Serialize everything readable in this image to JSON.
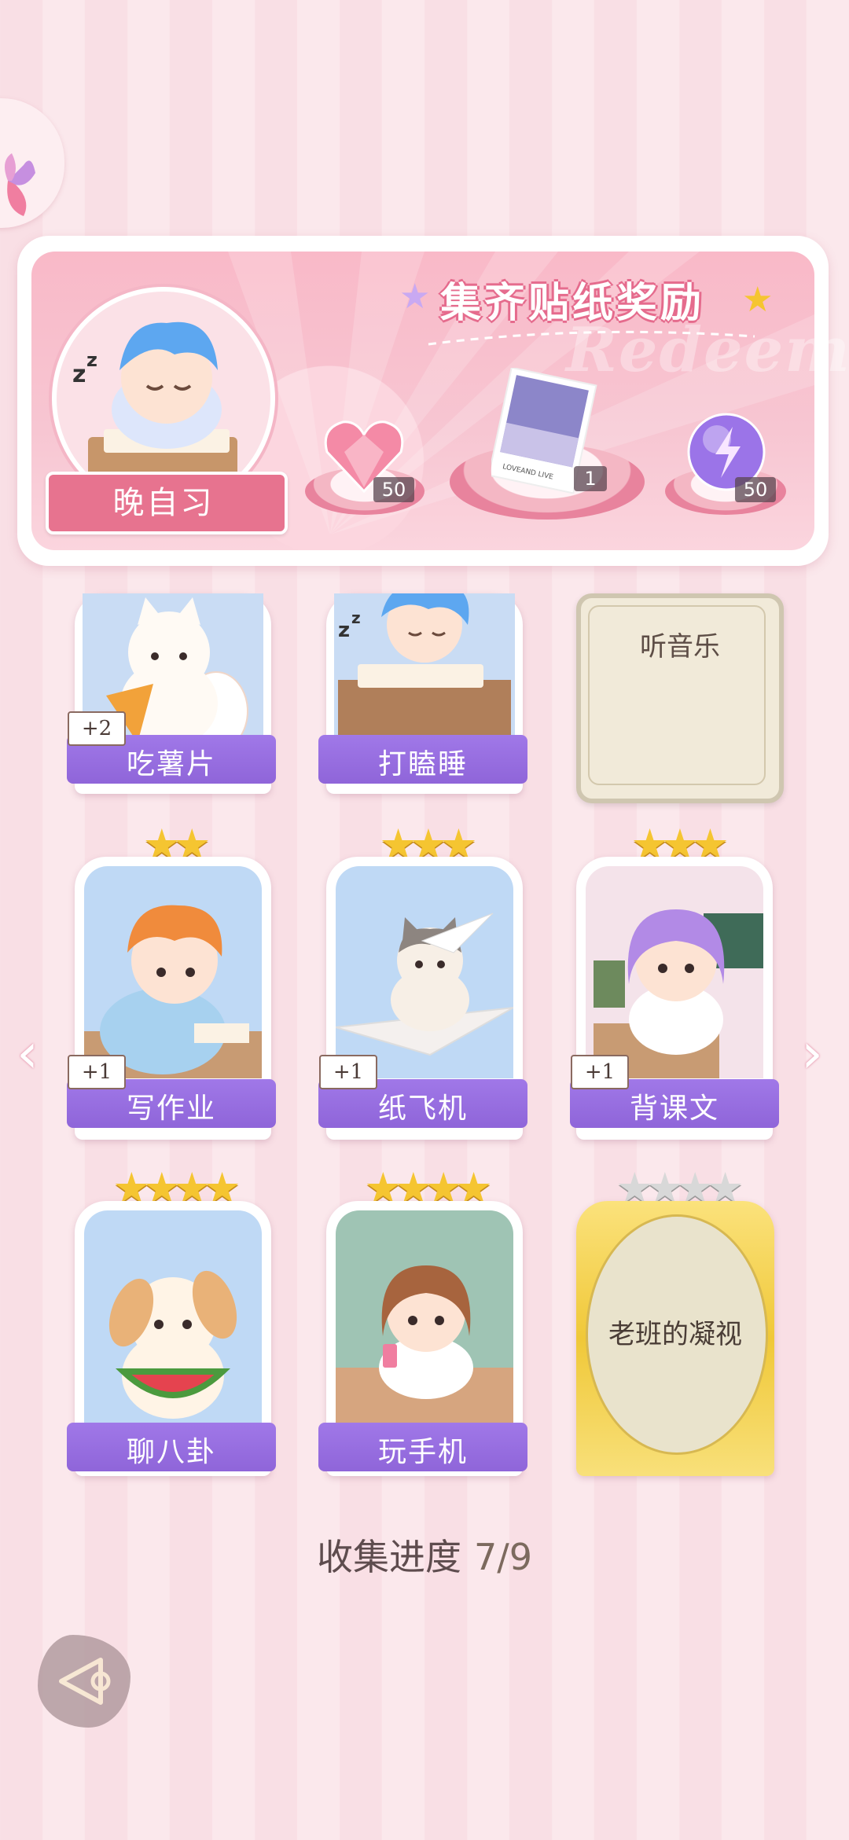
{
  "banner": {
    "title": "集齐贴纸奖励",
    "watermark": "Redeem",
    "sticker_name": "晚自习",
    "rewards": [
      {
        "icon": "pink-heart-gem-icon",
        "count": "50"
      },
      {
        "icon": "photo-card-icon",
        "count": "1",
        "photo_caption": "LOVEAND LIVE"
      },
      {
        "icon": "purple-energy-orb-icon",
        "count": "50"
      }
    ]
  },
  "cards": {
    "row1": [
      {
        "label": "吃薯片",
        "plus": "+2",
        "stars": 0,
        "art": "cat-eating-chips"
      },
      {
        "label": "打瞌睡",
        "plus": "",
        "stars": 0,
        "art": "boy-sleeping-desk"
      },
      {
        "label": "听音乐",
        "locked": true
      }
    ],
    "row2": [
      {
        "label": "写作业",
        "plus": "+1",
        "stars": 2,
        "art": "boy-writing"
      },
      {
        "label": "纸飞机",
        "plus": "+1",
        "stars": 3,
        "art": "cat-paper-plane"
      },
      {
        "label": "背课文",
        "plus": "+1",
        "stars": 3,
        "art": "girl-reciting"
      }
    ],
    "row3": [
      {
        "label": "聊八卦",
        "plus": "",
        "stars": 4,
        "art": "dog-watermelon"
      },
      {
        "label": "玩手机",
        "plus": "",
        "stars": 4,
        "art": "girl-phone"
      },
      {
        "label": "老班的凝视",
        "special": true,
        "stars": 4,
        "stars_filled": 0
      }
    ]
  },
  "progress": {
    "label": "收集进度",
    "value": "7/9"
  },
  "colors": {
    "label_purple": "#9b70e2",
    "ribbon_pink": "#e7738f",
    "star_gold": "#f5c531"
  }
}
